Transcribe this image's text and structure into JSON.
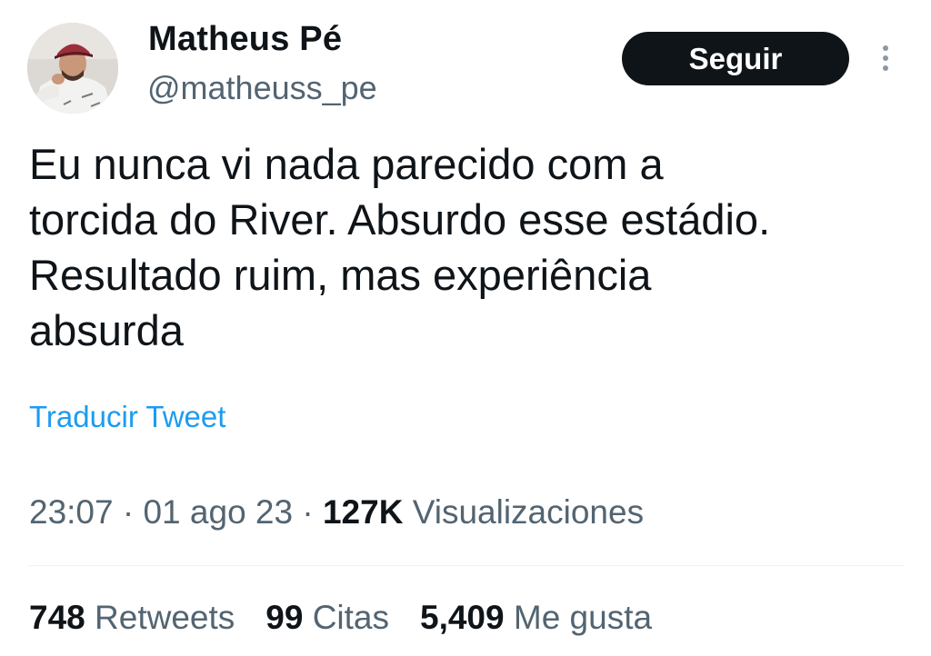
{
  "author": {
    "name": "Matheus Pé",
    "handle": "@matheuss_pe"
  },
  "actions": {
    "follow_label": "Seguir"
  },
  "tweet": {
    "text": "Eu nunca vi nada parecido com a\ntorcida do River. Absurdo esse estádio.\nResultado ruim, mas experiência\nabsurda",
    "translate_label": "Traducir Tweet",
    "time": "23:07",
    "separator": "·",
    "date": "01 ago 23",
    "views_count": "127K",
    "views_label": "Visualizaciones"
  },
  "stats": [
    {
      "count": "748",
      "label": "Retweets"
    },
    {
      "count": "99",
      "label": "Citas"
    },
    {
      "count": "5,409",
      "label": "Me gusta"
    }
  ],
  "icons": {
    "more": "more-vertical-icon",
    "avatar": "profile-avatar"
  },
  "colors": {
    "text": "#0f1419",
    "secondary": "#536471",
    "link": "#1d9bf0",
    "button_bg": "#0f1419",
    "button_text": "#ffffff"
  }
}
